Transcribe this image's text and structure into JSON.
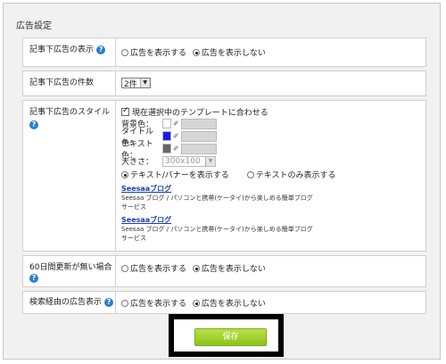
{
  "panel": {
    "title": "広告設定"
  },
  "rows": {
    "display": {
      "label": "記事下広告の表示",
      "options": [
        "広告を表示する",
        "広告を表示しない"
      ],
      "selected_index": 1
    },
    "count": {
      "label": "記事下広告の件数",
      "value": "2件"
    },
    "style": {
      "label": "記事下広告のスタイル",
      "template_check": "現在選択中のテンプレートに合わせる",
      "template_checked": true,
      "bg_label": "背景色：",
      "title_label": "タイトル色：",
      "text_label": "テキスト色：",
      "size_label": "大きさ：",
      "size_value": "300x100",
      "bg_color": "#ffffff",
      "title_color": "#1a1ae8",
      "text_color": "#666666",
      "mode_options": [
        "テキスト/バナーを表示する",
        "テキストのみ表示する"
      ],
      "mode_selected": 0,
      "ads": [
        {
          "title": "Seesaaブログ",
          "desc": "Seesaa ブログ / パソコンと携帯(ケータイ)から楽しめる簡単ブログ",
          "desc2": "サービス"
        },
        {
          "title": "Seesaaブログ",
          "desc": "Seesaa ブログ / パソコンと携帯(ケータイ)から楽しめる簡単ブログ",
          "desc2": "サービス"
        }
      ]
    },
    "inactive": {
      "label": "60日間更新が無い場合",
      "options": [
        "広告を表示する",
        "広告を表示しない"
      ],
      "selected_index": 1
    },
    "search": {
      "label": "検索経由の広告表示",
      "options": [
        "広告を表示する",
        "広告を表示しない"
      ],
      "selected_index": 1
    }
  },
  "save": {
    "label": "保存"
  },
  "icons": {
    "help": "help-icon"
  }
}
